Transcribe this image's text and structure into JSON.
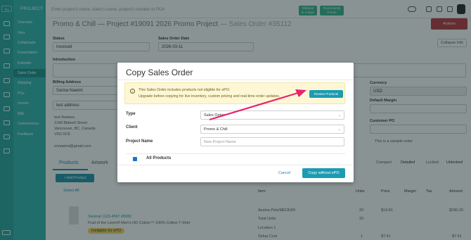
{
  "app": {
    "logo_text": "Tim",
    "section_title": "PROJECT",
    "nav": [
      "Overview",
      "Files",
      "Collaborate",
      "Presentation",
      "Estimate",
      "Sales Order",
      "Shipping",
      "POs",
      "Invoice",
      "Bills",
      "Commissions",
      "Feedback"
    ],
    "active_nav": "Sales Order"
  },
  "topbar": {
    "search_placeholder": "Enter project's name, client's name, project's number or PO#",
    "btn_webinar": [
      "Webinar",
      "in 4 days"
    ],
    "btn_community": [
      "#community",
      "Forum"
    ]
  },
  "page": {
    "title_main": "Promo & Chill — Project #19091 2026 Promo Project",
    "title_so": "— Sales Order #35112",
    "actions_label": "Actions",
    "collapse_label": "Collapse Info",
    "status_label": "Status",
    "status_value": "Invoiced",
    "date_label": "Sales Order Date",
    "date_value": "2026-03-11",
    "intro_label": "Introduction",
    "billing_label": "Billing Address",
    "billing_contact": "Sarina Naeimi",
    "billing_addr_field": "test address",
    "billing_lines": [
      "test Avalara",
      "1168 Bidwell Street",
      "Vancouver, BC, Canada",
      "V6G 0C6"
    ],
    "billing_email": "znnaeimi@gmail.com",
    "currency_label": "Currency",
    "currency_value": "USD",
    "margin_label": "Default Margin",
    "customer_po_label": "Customer PO",
    "sample_label": "This is a sample order",
    "tabs": [
      "Products",
      "Artwork"
    ],
    "view_tabs": [
      "Compact",
      "Detailed",
      "Locked",
      "Unlocked"
    ],
    "add_product": "+ Add Product",
    "select_all": "Select All",
    "table_headers": [
      "Item",
      "Units",
      "Price",
      "Margin",
      "Tax",
      "Amount"
    ],
    "row": {
      "sku_label": "Sanmar (123-4567-8900)",
      "desc": "Fruit of the Loom® Men's HD Cotton™ 100% Cotton T-Shirt",
      "badge": "Ineligible for ePO",
      "item": "Azalea Pink/MEDIUM",
      "units": "20",
      "price": "$14.81",
      "amount": "$296.20",
      "total_label": "Total Units",
      "total_units": "20",
      "location": "Location 1",
      "setup": "Setup Cost",
      "setup_units": "1",
      "setup_price": "$7.41",
      "setup_amount": "$7.41"
    }
  },
  "modal": {
    "title": "Copy Sales Order",
    "warning_line1": "This Sales Order includes products not eligible for ePO.",
    "warning_line2": "Upgrade before copying for live inventory, custom pricing and real-time order updates.",
    "review_button": "Review Products",
    "type_label": "Type",
    "type_value": "Sales Order",
    "client_label": "Client",
    "client_value": "Promo & Chill",
    "project_label": "Project Name",
    "project_placeholder": "New Project Name",
    "all_products_label": "All Products",
    "cancel_label": "Cancel",
    "copy_label": "Copy without ePO",
    "arrow_color": "#e8236f"
  }
}
